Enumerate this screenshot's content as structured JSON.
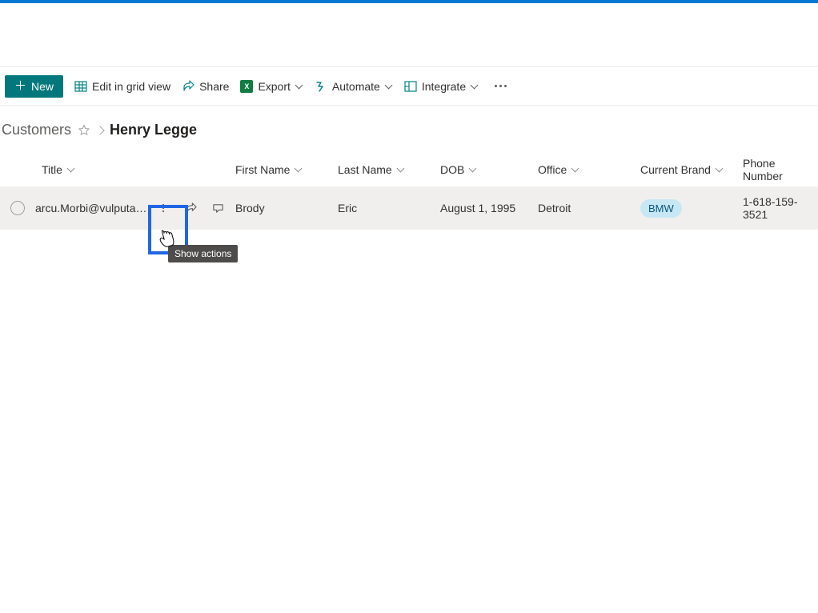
{
  "commandBar": {
    "new": "New",
    "editGrid": "Edit in grid view",
    "share": "Share",
    "export": "Export",
    "automate": "Automate",
    "integrate": "Integrate"
  },
  "breadcrumb": {
    "root": "Customers",
    "current": "Henry Legge"
  },
  "columns": {
    "title": "Title",
    "firstName": "First Name",
    "lastName": "Last Name",
    "dob": "DOB",
    "office": "Office",
    "currentBrand": "Current Brand",
    "phone": "Phone Number"
  },
  "row": {
    "title": "arcu.Morbi@vulputatedui...",
    "firstName": "Brody",
    "lastName": "Eric",
    "dob": "August 1, 1995",
    "office": "Detroit",
    "brand": "BMW",
    "phone": "1-618-159-3521"
  },
  "tooltip": "Show actions"
}
